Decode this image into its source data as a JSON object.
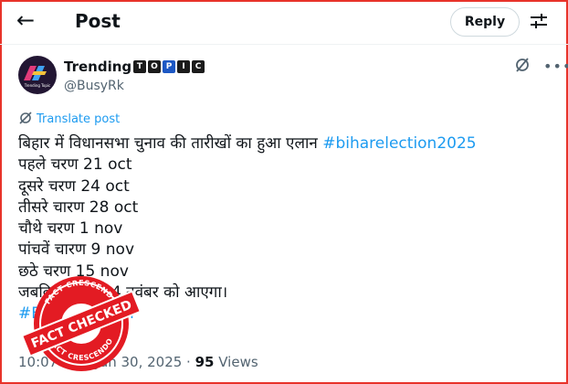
{
  "header": {
    "back_icon": "arrow-left-icon",
    "title": "Post",
    "reply_label": "Reply",
    "settings_icon": "sliders-icon"
  },
  "author": {
    "name": "Trending",
    "badges": [
      "T",
      "O",
      "P",
      "I",
      "C"
    ],
    "handle": "@BusyRk",
    "avatar_text": "Trending Topic",
    "grok_icon": "grok-icon",
    "more_icon": "more-dots-icon"
  },
  "translate": {
    "label": "Translate post",
    "icon": "translate-icon"
  },
  "post": {
    "lines": [
      {
        "text": "बिहार में विधानसभा चुनाव की तारीखों का हुआ एलान ",
        "hashtag": "#biharelection2025"
      },
      {
        "text": "पहले चरण 21 oct",
        "hashtag": ""
      },
      {
        "text": "दूसरे चरण 24 oct",
        "hashtag": ""
      },
      {
        "text": "तीसरे चारण 28 oct",
        "hashtag": ""
      },
      {
        "text": "चौथे चरण 1 nov",
        "hashtag": ""
      },
      {
        "text": "पांचवें चारण 9 nov",
        "hashtag": ""
      },
      {
        "text": "छठे चरण 15 nov",
        "hashtag": ""
      },
      {
        "text": "जबकि नतीजा 24 नवंबर को आएगा।",
        "hashtag": ""
      },
      {
        "text": "",
        "hashtag": "#BiharElection"
      }
    ]
  },
  "meta": {
    "time": "10:07 PM · Jun 30, 2025 · ",
    "views_count": "95",
    "views_label": " Views"
  },
  "stamp": {
    "top_text": "FACT CRESCENDO",
    "main_text": "FACT CHECKED",
    "bottom_text": "FACT CRESCENDO",
    "color": "#e31b23"
  }
}
